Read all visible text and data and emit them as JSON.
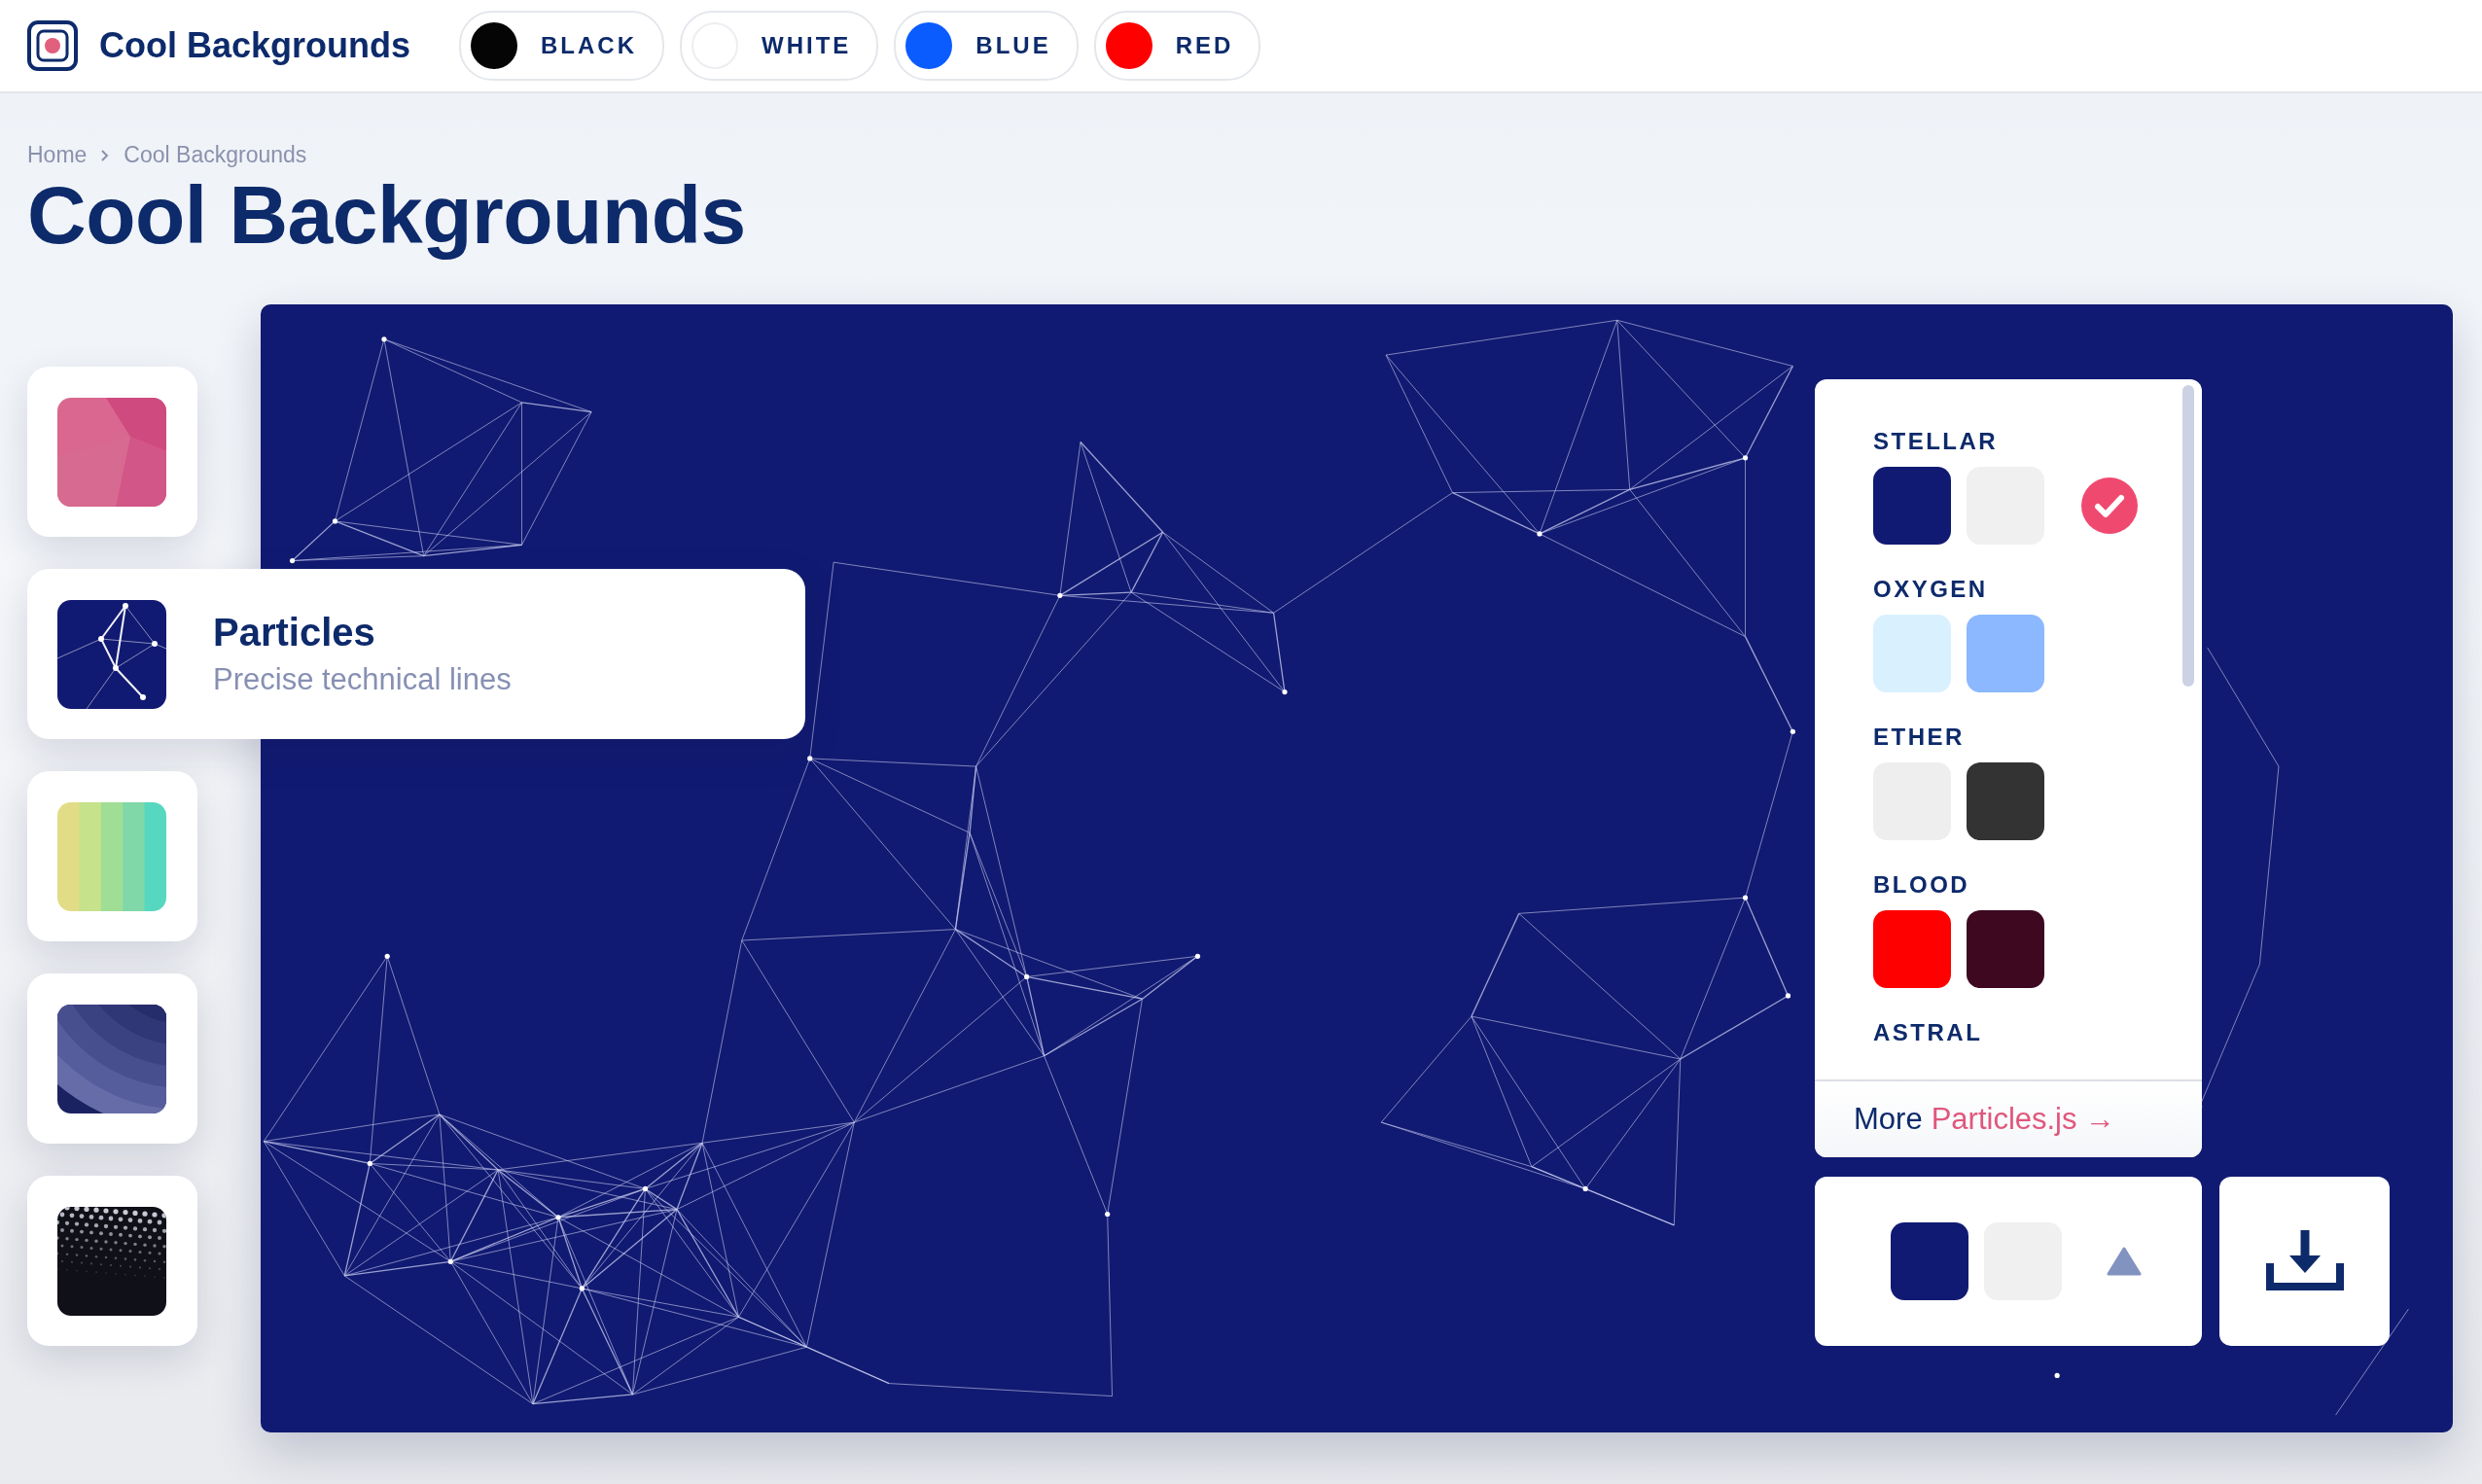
{
  "header": {
    "brand": "Cool Backgrounds",
    "chips": [
      {
        "label": "BLACK",
        "color": "#050505"
      },
      {
        "label": "WHITE",
        "color": "#ffffff"
      },
      {
        "label": "BLUE",
        "color": "#0a5cff"
      },
      {
        "label": "RED",
        "color": "#ff0000"
      }
    ]
  },
  "breadcrumb": [
    "Home",
    "Cool Backgrounds"
  ],
  "title": "Cool Backgrounds",
  "styles": [
    {
      "kind": "low-poly",
      "selected": false
    },
    {
      "kind": "particles",
      "selected": true,
      "name": "Particles",
      "description": "Precise technical lines"
    },
    {
      "kind": "gradient",
      "selected": false
    },
    {
      "kind": "waves",
      "selected": false
    },
    {
      "kind": "dots",
      "selected": false
    }
  ],
  "palettes": [
    {
      "name": "STELLAR",
      "selected": true,
      "colors": [
        {
          "color": "#111a72"
        },
        {
          "color": "#f0f0f0"
        }
      ]
    },
    {
      "name": "OXYGEN",
      "selected": false,
      "colors": [
        {
          "color": "#d9f1ff"
        },
        {
          "color": "#8bb8ff"
        }
      ]
    },
    {
      "name": "ETHER",
      "selected": false,
      "colors": [
        {
          "color": "#eeeeee"
        },
        {
          "color": "#333333"
        }
      ]
    },
    {
      "name": "BLOOD",
      "selected": false,
      "colors": [
        {
          "color": "#ff0000"
        },
        {
          "color": "#3d0820"
        }
      ]
    },
    {
      "name": "ASTRAL"
    }
  ],
  "more": {
    "prefix": "More",
    "link": "Particles.js →"
  },
  "current": {
    "colors": [
      {
        "color": "#111a72"
      },
      {
        "color": "#f0f0f0"
      }
    ]
  }
}
